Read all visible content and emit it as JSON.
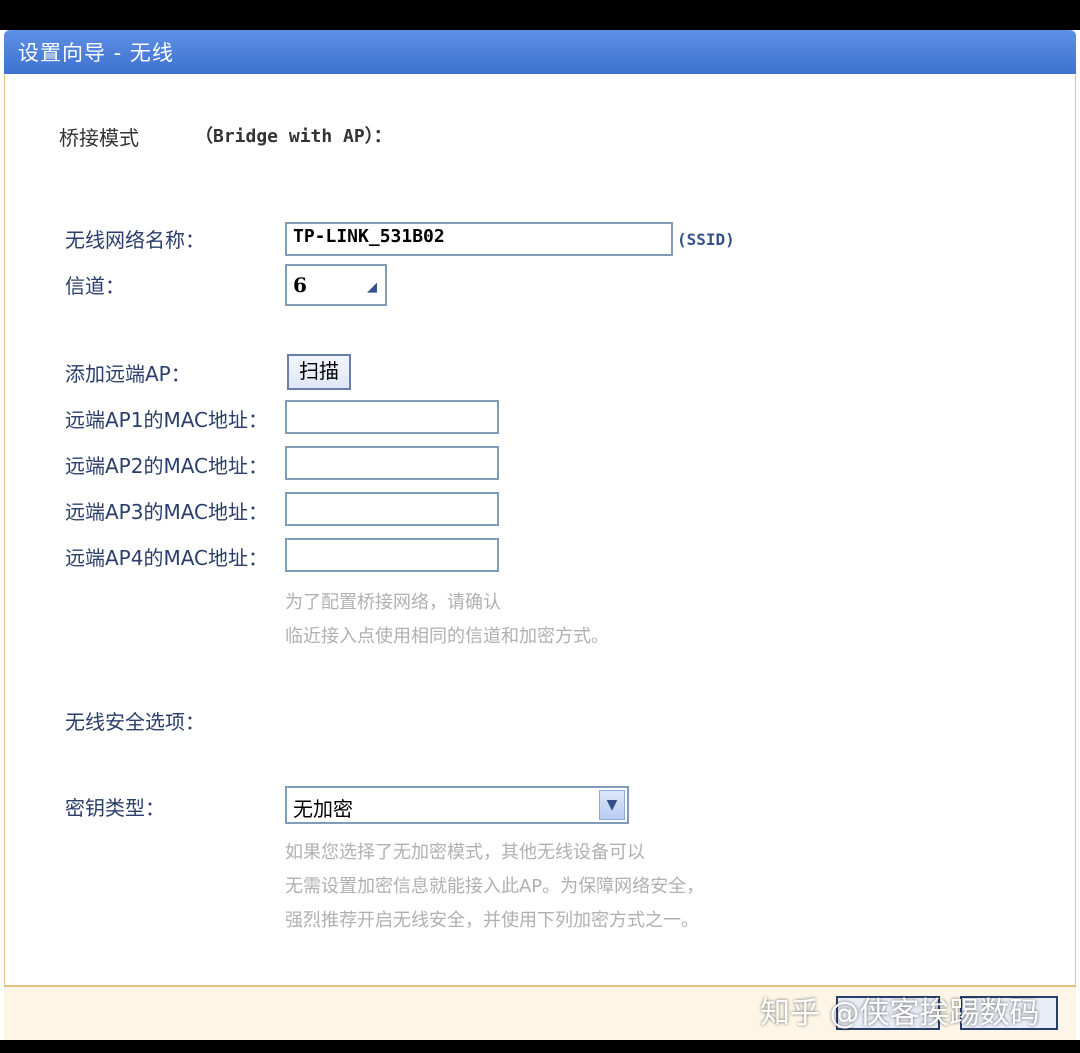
{
  "window": {
    "title": "设置向导 - 无线"
  },
  "mode": {
    "label": "桥接模式",
    "value": "（Bridge with AP）："
  },
  "ssid": {
    "label": "无线网络名称：",
    "value": "TP-LINK_531B02",
    "suffix": "(SSID)"
  },
  "channel": {
    "label": "信道：",
    "value": "6"
  },
  "remote_ap": {
    "label": "添加远端AP：",
    "scan_button": "扫描",
    "mac_fields": [
      {
        "label": "远端AP1的MAC地址：",
        "value": ""
      },
      {
        "label": "远端AP2的MAC地址：",
        "value": ""
      },
      {
        "label": "远端AP3的MAC地址：",
        "value": ""
      },
      {
        "label": "远端AP4的MAC地址：",
        "value": ""
      }
    ],
    "hint_lines": [
      "为了配置桥接网络，请确认",
      "临近接入点使用相同的信道和加密方式。"
    ]
  },
  "security": {
    "label": "无线安全选项：",
    "key_type_label": "密钥类型：",
    "key_type_value": "无加密",
    "hint_lines": [
      "如果您选择了无加密模式，其他无线设备可以",
      "无需设置加密信息就能接入此AP。为保障网络安全，",
      "强烈推荐开启无线安全，并使用下列加密方式之一。"
    ]
  },
  "watermark": "知乎 @侠客挨踢数码",
  "colors": {
    "title_bar": "#4a7ddb",
    "label_text": "#2b3e6b",
    "hint_text": "#b0b0b0",
    "footer_border": "#e6c27f"
  }
}
